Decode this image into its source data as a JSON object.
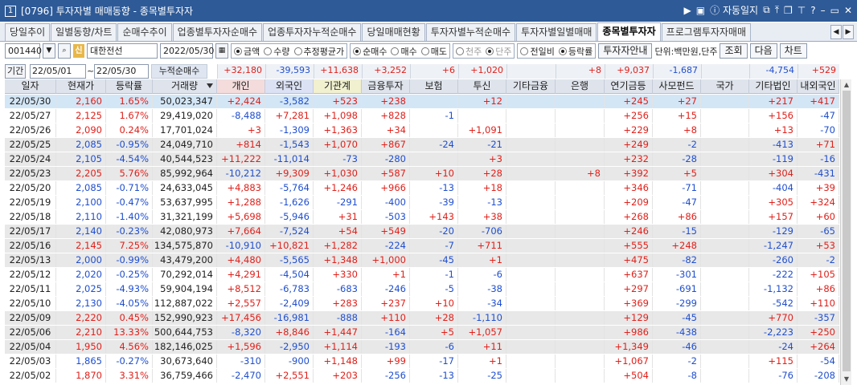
{
  "window": {
    "number": "1",
    "title": "[0796] 투자자별 매매동향 - 종목별투자자",
    "auto_label": "자동일지",
    "help": "?"
  },
  "tabs": [
    "당일추이",
    "일별동향/차트",
    "순매수추이",
    "업종별투자자순매수",
    "업종투자자누적순매수",
    "당일매매현황",
    "투자자별누적순매수",
    "투자자별일별매매",
    "종목별투자자",
    "프로그램투자자매매"
  ],
  "active_tab": 8,
  "controls": {
    "code": "001440",
    "credit_badge": "신",
    "stock_name": "대한전선",
    "date": "2022/05/30",
    "group1": [
      {
        "label": "금액",
        "on": true
      },
      {
        "label": "수량",
        "on": false
      },
      {
        "label": "추정평균가",
        "on": false
      }
    ],
    "group2": [
      {
        "label": "순매수",
        "on": true
      },
      {
        "label": "매수",
        "on": false
      },
      {
        "label": "매도",
        "on": false
      }
    ],
    "group3": [
      {
        "label": "천주",
        "on": false,
        "disabled": true
      },
      {
        "label": "단주",
        "on": true,
        "disabled": true
      }
    ],
    "group4": [
      {
        "label": "전일비",
        "on": false
      },
      {
        "label": "등락률",
        "on": true
      }
    ],
    "guide_btn": "투자자안내",
    "unit_label": "단위:백만원,단주",
    "query_btn": "조회",
    "next_btn": "다음",
    "chart_btn": "차트"
  },
  "period": {
    "label": "기간",
    "from": "22/05/01",
    "to": "22/05/30",
    "cum_label": "누적순매수",
    "sums": [
      "+32,180",
      "-39,593",
      "+11,638",
      "+3,252",
      "+6",
      "+1,020",
      "",
      "+8",
      "+9,037",
      "-1,687",
      "",
      "-4,754",
      "+529"
    ]
  },
  "columns": [
    "일자",
    "현재가",
    "등락률",
    "거래량",
    "개인",
    "외국인",
    "기관계",
    "금융투자",
    "보험",
    "투신",
    "기타금융",
    "은행",
    "연기금등",
    "사모펀드",
    "국가",
    "기타법인",
    "내외국인"
  ],
  "rows": [
    [
      "22/05/30",
      "2,160",
      "1.65%",
      "50,023,347",
      "+2,424",
      "-3,582",
      "+523",
      "+238",
      "",
      "+12",
      "",
      "",
      "+245",
      "+27",
      "",
      "+217",
      "+417"
    ],
    [
      "22/05/27",
      "2,125",
      "1.67%",
      "29,419,020",
      "-8,488",
      "+7,281",
      "+1,098",
      "+828",
      "-1",
      "",
      "",
      "",
      "+256",
      "+15",
      "",
      "+156",
      "-47"
    ],
    [
      "22/05/26",
      "2,090",
      "0.24%",
      "17,701,024",
      "+3",
      "-1,309",
      "+1,363",
      "+34",
      "",
      "+1,091",
      "",
      "",
      "+229",
      "+8",
      "",
      "+13",
      "-70"
    ],
    [
      "22/05/25",
      "2,085",
      "-0.95%",
      "24,049,710",
      "+814",
      "-1,543",
      "+1,070",
      "+867",
      "-24",
      "-21",
      "",
      "",
      "+249",
      "-2",
      "",
      "-413",
      "+71"
    ],
    [
      "22/05/24",
      "2,105",
      "-4.54%",
      "40,544,523",
      "+11,222",
      "-11,014",
      "-73",
      "-280",
      "",
      "+3",
      "",
      "",
      "+232",
      "-28",
      "",
      "-119",
      "-16"
    ],
    [
      "22/05/23",
      "2,205",
      "5.76%",
      "85,992,964",
      "-10,212",
      "+9,309",
      "+1,030",
      "+587",
      "+10",
      "+28",
      "",
      "+8",
      "+392",
      "+5",
      "",
      "+304",
      "-431"
    ],
    [
      "22/05/20",
      "2,085",
      "-0.71%",
      "24,633,045",
      "+4,883",
      "-5,764",
      "+1,246",
      "+966",
      "-13",
      "+18",
      "",
      "",
      "+346",
      "-71",
      "",
      "-404",
      "+39"
    ],
    [
      "22/05/19",
      "2,100",
      "-0.47%",
      "53,637,995",
      "+1,288",
      "-1,626",
      "-291",
      "-400",
      "-39",
      "-13",
      "",
      "",
      "+209",
      "-47",
      "",
      "+305",
      "+324"
    ],
    [
      "22/05/18",
      "2,110",
      "-1.40%",
      "31,321,199",
      "+5,698",
      "-5,946",
      "+31",
      "-503",
      "+143",
      "+38",
      "",
      "",
      "+268",
      "+86",
      "",
      "+157",
      "+60"
    ],
    [
      "22/05/17",
      "2,140",
      "-0.23%",
      "42,080,973",
      "+7,664",
      "-7,524",
      "+54",
      "+549",
      "-20",
      "-706",
      "",
      "",
      "+246",
      "-15",
      "",
      "-129",
      "-65"
    ],
    [
      "22/05/16",
      "2,145",
      "7.25%",
      "134,575,870",
      "-10,910",
      "+10,821",
      "+1,282",
      "-224",
      "-7",
      "+711",
      "",
      "",
      "+555",
      "+248",
      "",
      "-1,247",
      "+53"
    ],
    [
      "22/05/13",
      "2,000",
      "-0.99%",
      "43,479,200",
      "+4,480",
      "-5,565",
      "+1,348",
      "+1,000",
      "-45",
      "+1",
      "",
      "",
      "+475",
      "-82",
      "",
      "-260",
      "-2"
    ],
    [
      "22/05/12",
      "2,020",
      "-0.25%",
      "70,292,014",
      "+4,291",
      "-4,504",
      "+330",
      "+1",
      "-1",
      "-6",
      "",
      "",
      "+637",
      "-301",
      "",
      "-222",
      "+105"
    ],
    [
      "22/05/11",
      "2,025",
      "-4.93%",
      "59,904,194",
      "+8,512",
      "-6,783",
      "-683",
      "-246",
      "-5",
      "-38",
      "",
      "",
      "+297",
      "-691",
      "",
      "-1,132",
      "+86"
    ],
    [
      "22/05/10",
      "2,130",
      "-4.05%",
      "112,887,022",
      "+2,557",
      "-2,409",
      "+283",
      "+237",
      "+10",
      "-34",
      "",
      "",
      "+369",
      "-299",
      "",
      "-542",
      "+110"
    ],
    [
      "22/05/09",
      "2,220",
      "0.45%",
      "152,990,923",
      "+17,456",
      "-16,981",
      "-888",
      "+110",
      "+28",
      "-1,110",
      "",
      "",
      "+129",
      "-45",
      "",
      "+770",
      "-357"
    ],
    [
      "22/05/06",
      "2,210",
      "13.33%",
      "500,644,753",
      "-8,320",
      "+8,846",
      "+1,447",
      "-164",
      "+5",
      "+1,057",
      "",
      "",
      "+986",
      "-438",
      "",
      "-2,223",
      "+250"
    ],
    [
      "22/05/04",
      "1,950",
      "4.56%",
      "182,146,025",
      "+1,596",
      "-2,950",
      "+1,114",
      "-193",
      "-6",
      "+11",
      "",
      "",
      "+1,349",
      "-46",
      "",
      "-24",
      "+264"
    ],
    [
      "22/05/03",
      "1,865",
      "-0.27%",
      "30,673,640",
      "-310",
      "-900",
      "+1,148",
      "+99",
      "-17",
      "+1",
      "",
      "",
      "+1,067",
      "-2",
      "",
      "+115",
      "-54"
    ],
    [
      "22/05/02",
      "1,870",
      "3.31%",
      "36,759,466",
      "-2,470",
      "+2,551",
      "+203",
      "-256",
      "-13",
      "-25",
      "",
      "",
      "+504",
      "-8",
      "",
      "-76",
      "-208"
    ]
  ],
  "colors": {
    "up": "#e0201a",
    "down": "#1f4fd0",
    "selected": "#d3e6f6",
    "shade": "#e8e8e8",
    "title": "#2e5a97"
  }
}
